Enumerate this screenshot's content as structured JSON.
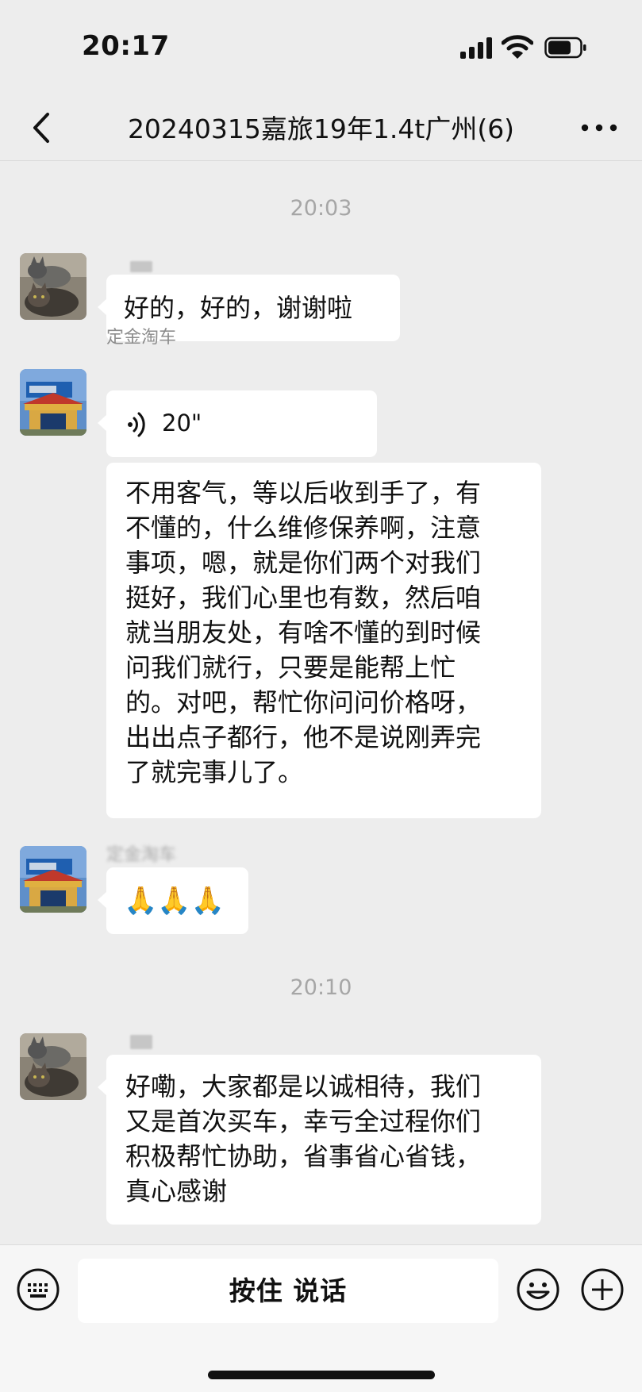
{
  "status_bar": {
    "time": "20:17",
    "signal": "signal-bars-icon",
    "wifi": "wifi-icon",
    "battery": "battery-icon"
  },
  "nav": {
    "title": "20240315嘉旅19年1.4t广州(6)",
    "back_icon": "chevron-left-icon",
    "more_icon": "more-dots-icon"
  },
  "messages": {
    "time1": "20:03",
    "msg1": {
      "text": "好的，好的，谢谢啦"
    },
    "msg2": {
      "sender": "定金淘车",
      "voice_duration": "20\""
    },
    "msg3": {
      "lines": [
        "不用客气，等以后收到手了，有",
        "不懂的，什么维修保养啊，注意",
        "事项，嗯，就是你们两个对我们",
        "挺好，我们心里也有数，然后咱",
        "就当朋友处，有啥不懂的到时候",
        "问我们就行，只要是能帮上忙",
        "的。对吧，帮忙你问问价格呀，",
        "出出点子都行，他不是说刚弄完",
        "了就完事儿了。"
      ]
    },
    "msg4": {
      "sender": "定金淘车",
      "emoji": "🙏🙏🙏"
    },
    "time2": "20:10",
    "msg5": {
      "lines": [
        "好嘞，大家都是以诚相待，我们",
        "又是首次买车，幸亏全过程你们",
        "积极帮忙协助，省事省心省钱，",
        "真心感谢"
      ]
    }
  },
  "input_bar": {
    "talk_label": "按住 说话",
    "keyboard_icon": "keyboard-icon",
    "emoji_icon": "emoji-icon",
    "plus_icon": "plus-icon"
  },
  "colors": {
    "background": "#ededed",
    "bubble": "#ffffff",
    "time_text": "#a6a6a6"
  }
}
